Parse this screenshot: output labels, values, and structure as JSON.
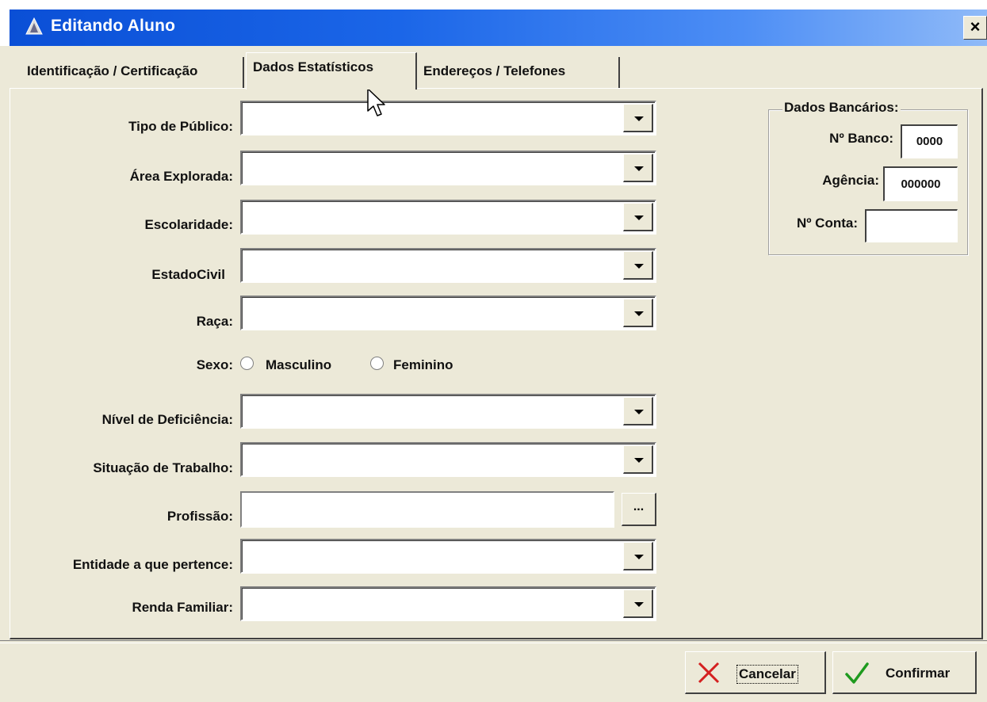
{
  "window": {
    "title": "Editando Aluno",
    "close_label": "×"
  },
  "tabs": [
    {
      "label": "Identificação / Certificação"
    },
    {
      "label": "Dados Estatísticos"
    },
    {
      "label": "Endereços / Telefones"
    }
  ],
  "fields": {
    "tipo_publico": {
      "label": "Tipo de Público:",
      "value": ""
    },
    "area_explorada": {
      "label": "Área Explorada:",
      "value": ""
    },
    "escolaridade": {
      "label": "Escolaridade:",
      "value": ""
    },
    "estado_civil": {
      "label": "EstadoCivil",
      "value": ""
    },
    "raca": {
      "label": "Raça:",
      "value": ""
    },
    "sexo": {
      "label": "Sexo:",
      "option_masculino": "Masculino",
      "option_feminino": "Feminino"
    },
    "nivel_deficiencia": {
      "label": "Nível de Deficiência:",
      "value": ""
    },
    "situacao_trabalho": {
      "label": "Situação de Trabalho:",
      "value": ""
    },
    "profissao": {
      "label": "Profissão:",
      "value": "",
      "browse_label": "..."
    },
    "entidade": {
      "label": "Entidade a que pertence:",
      "value": ""
    },
    "renda_familiar": {
      "label": "Renda Familiar:",
      "value": ""
    }
  },
  "bank": {
    "title": "Dados Bancários:",
    "banco_label": "Nº Banco:",
    "banco_value": "0000",
    "agencia_label": "Agência:",
    "agencia_value": "000000",
    "conta_label": "Nº Conta:",
    "conta_value": ""
  },
  "buttons": {
    "cancel": "Cancelar",
    "confirm": "Confirmar"
  },
  "colors": {
    "titlebar_start": "#0a4fd6",
    "titlebar_end": "#8fbaf8",
    "face": "#ece9d8"
  }
}
